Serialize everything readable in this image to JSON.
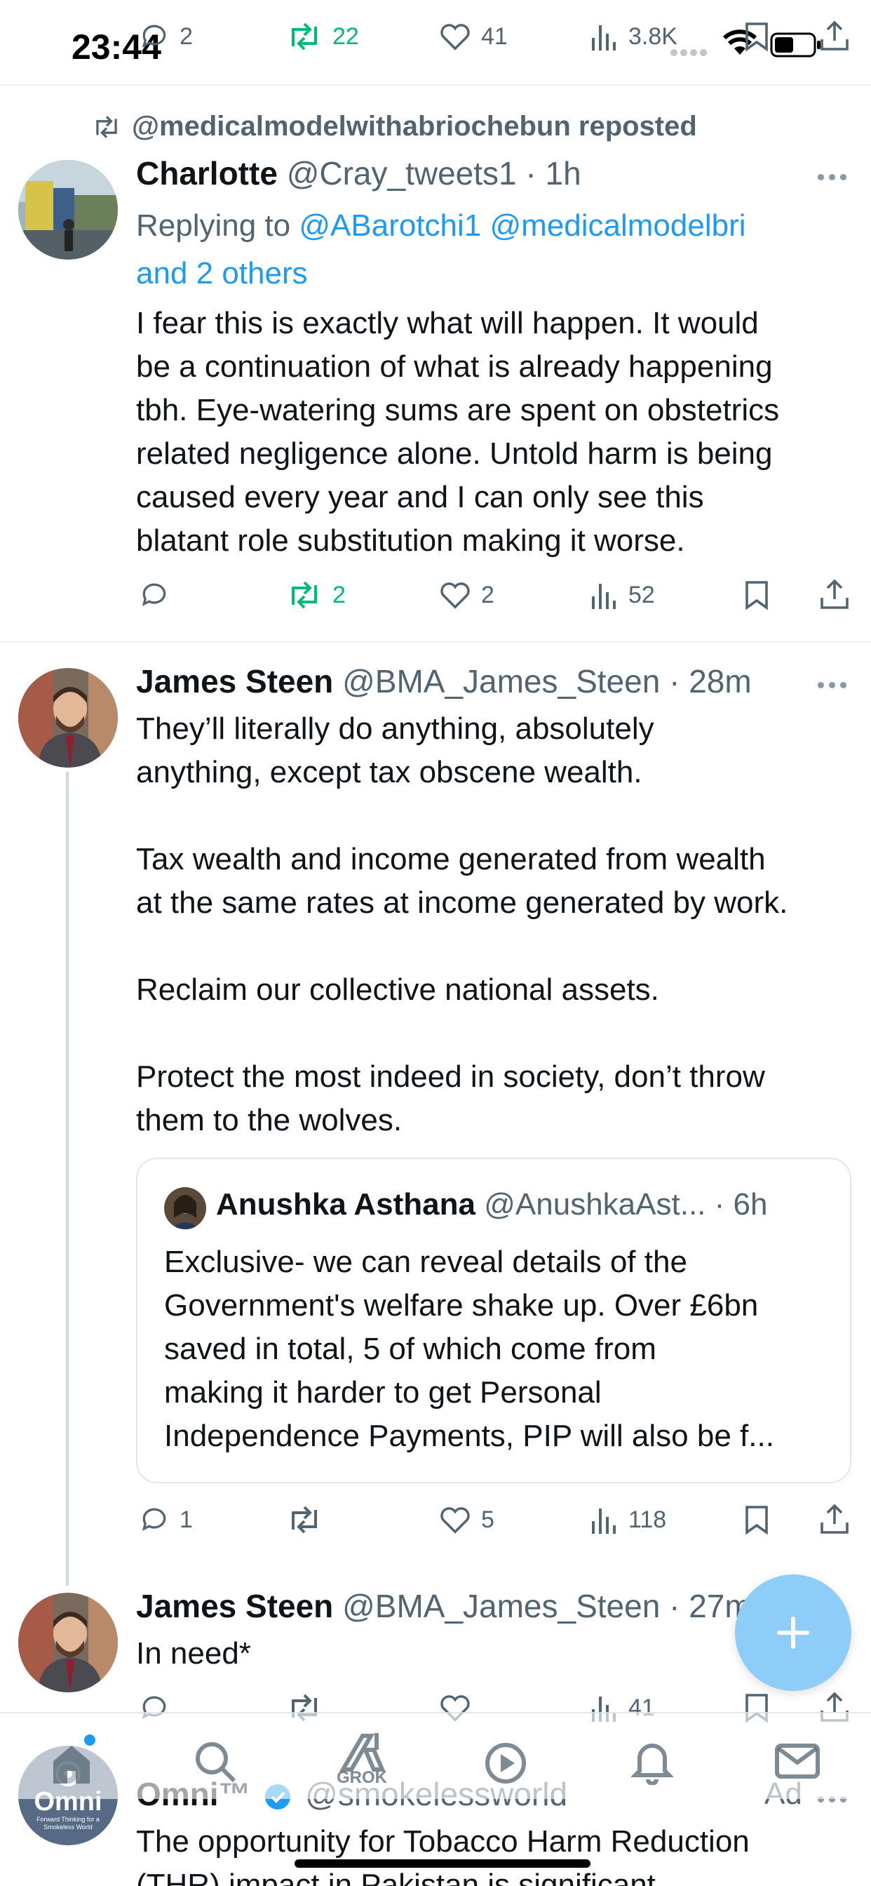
{
  "status_bar": {
    "time": "23:44"
  },
  "top_tweet_stats": {
    "replies": "2",
    "reposts": "22",
    "likes": "41",
    "views": "3.8K"
  },
  "tweet1": {
    "repost_label": "@medicalmodelwithabriochebun reposted",
    "name": "Charlotte",
    "handle": "@Cray_tweets1",
    "time": "· 1h",
    "replying_prefix": "Replying to",
    "replying_users": "@ABarotchi1 @medicalmodelbri",
    "replying_more": "and 2 others",
    "text": "I fear this is exactly what will happen. It would\nbe a continuation of what is already happening\ntbh. Eye-watering sums are spent on obstetrics\nrelated negligence alone. Untold harm is being\ncaused every year and I can only see this\nblatant role substitution making it worse.",
    "stats": {
      "replies": "",
      "reposts": "2",
      "likes": "2",
      "views": "52"
    }
  },
  "tweet2": {
    "name": "James Steen",
    "handle": "@BMA_James_Steen",
    "time": "· 28m",
    "text": "They’ll literally do anything, absolutely\nanything, except tax obscene wealth.\n\nTax wealth and income generated from wealth\nat the same rates at income generated by work.\n\nReclaim our collective national assets.\n\nProtect the most indeed in society, don’t throw\nthem to the wolves.",
    "quote": {
      "name": "Anushka Asthana",
      "handle": "@AnushkaAst...",
      "time": "· 6h",
      "text": "Exclusive- we can reveal details of the\nGovernment's welfare shake up. Over £6bn\nsaved in total, 5 of which come from\nmaking it harder to get Personal\nIndependence Payments, PIP will also be f..."
    },
    "stats": {
      "replies": "1",
      "reposts": "",
      "likes": "5",
      "views": "118"
    }
  },
  "tweet3": {
    "name": "James Steen",
    "handle": "@BMA_James_Steen",
    "time": "· 27m",
    "text": "In need*",
    "stats": {
      "views": "41"
    }
  },
  "ad": {
    "name": "Omni™",
    "handle": "@smokelessworld",
    "ad_label": "Ad",
    "text_line1": "The opportunity for Tobacco Harm Reduction",
    "text_line2": "(THR) impact in Pakistan is significant",
    "logo_text": "Omni",
    "logo_tagline": "Forward Thinking for a Smokeless World"
  },
  "nav": {
    "grok_label": "GROK"
  },
  "fab": {
    "icon": "plus-icon"
  },
  "colors": {
    "accent": "#1d9bf0",
    "repost_green": "#00ba7c",
    "text": "#0f1419",
    "muted": "#536471",
    "fab": "#8ecdf7"
  }
}
